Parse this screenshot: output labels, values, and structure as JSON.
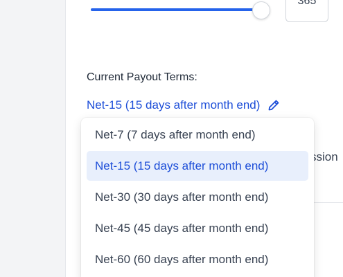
{
  "slider": {
    "value": 365,
    "fraction": 1.0,
    "input_value": "365",
    "accent": "#2563eb"
  },
  "payout": {
    "label": "Current Payout Terms:",
    "current": "Net-15 (15 days after month end)",
    "edit_icon": "pencil-icon"
  },
  "background": {
    "partial_heading": "ssion"
  },
  "dropdown": {
    "options": [
      {
        "label": "Net-7 (7 days after month end)",
        "selected": false
      },
      {
        "label": "Net-15 (15 days after month end)",
        "selected": true
      },
      {
        "label": "Net-30 (30 days after month end)",
        "selected": false
      },
      {
        "label": "Net-45 (45 days after month end)",
        "selected": false
      },
      {
        "label": "Net-60 (60 days after month end)",
        "selected": false
      }
    ]
  },
  "colors": {
    "link": "#1d4ed8",
    "selected_bg": "#e8effc"
  }
}
